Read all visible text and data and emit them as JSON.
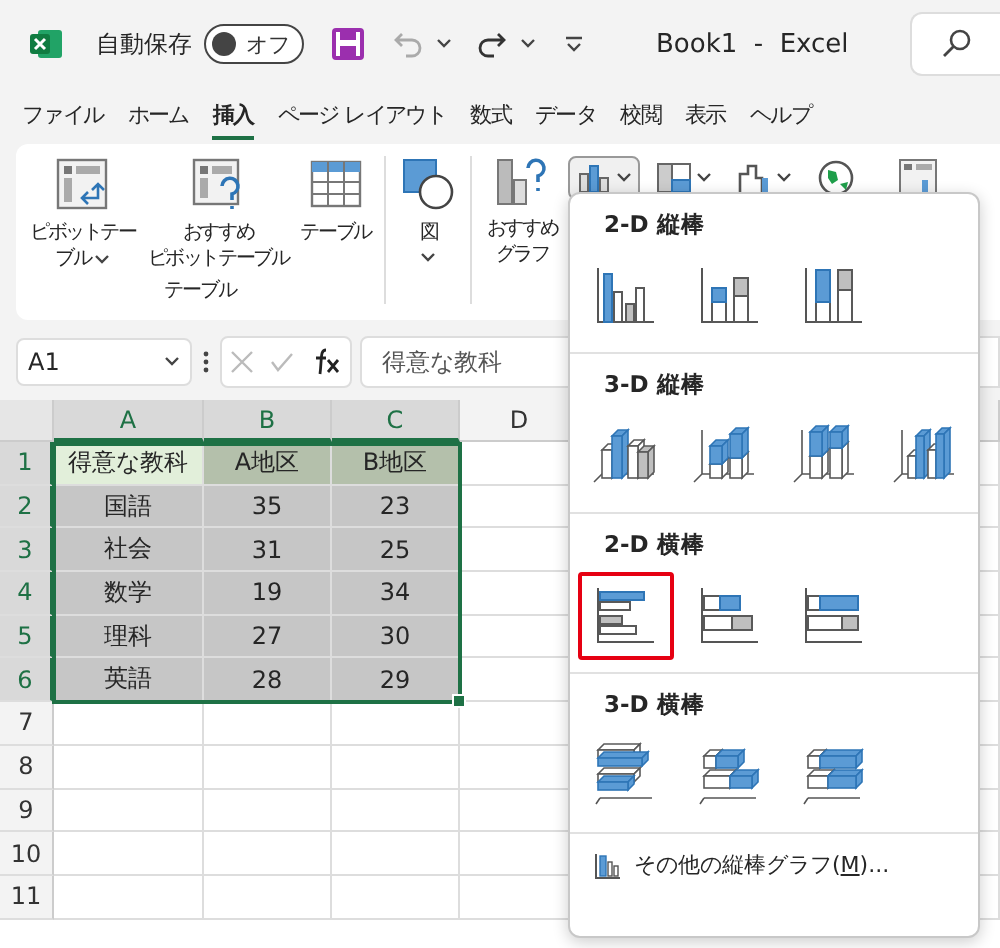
{
  "title_bar": {
    "autosave_label": "自動保存",
    "autosave_toggle": {
      "on": false,
      "label": "オフ"
    },
    "title": "Book1  -  Excel"
  },
  "menu_tabs": [
    {
      "label": "ファイル",
      "selected": false
    },
    {
      "label": "ホーム",
      "selected": false
    },
    {
      "label": "挿入",
      "selected": true
    },
    {
      "label": "ページ レイアウト",
      "selected": false
    },
    {
      "label": "数式",
      "selected": false
    },
    {
      "label": "データ",
      "selected": false
    },
    {
      "label": "校閲",
      "selected": false
    },
    {
      "label": "表示",
      "selected": false
    },
    {
      "label": "ヘルプ",
      "selected": false
    }
  ],
  "ribbon": {
    "groups": [
      {
        "label": "テーブル",
        "buttons": [
          {
            "kind": "pivot-table",
            "lines": [
              "ピボットテー",
              "ブル"
            ],
            "dropdown": true
          },
          {
            "kind": "recommended-pivot",
            "lines": [
              "おすすめ",
              "ピボットテーブル"
            ],
            "dropdown": false
          },
          {
            "kind": "table",
            "lines": [
              "テーブル"
            ],
            "dropdown": false
          }
        ]
      },
      {
        "buttons": [
          {
            "kind": "illustrations",
            "lines": [
              "図"
            ],
            "dropdown": true
          }
        ]
      },
      {
        "buttons": [
          {
            "kind": "recommended-charts",
            "lines": [
              "おすすめ",
              "グラフ"
            ],
            "dropdown": false
          }
        ],
        "chart_tools": [
          {
            "kind": "column",
            "dropdown": true,
            "pressed": true
          },
          {
            "kind": "hierarchy",
            "dropdown": true,
            "pressed": false
          },
          {
            "kind": "waterfall",
            "dropdown": true,
            "pressed": false
          },
          {
            "kind": "map",
            "dropdown": false,
            "pressed": false
          },
          {
            "kind": "pivot-chart",
            "dropdown": false,
            "pressed": false
          }
        ]
      }
    ]
  },
  "formula_bar": {
    "name_box": "A1",
    "formula": "得意な教科"
  },
  "sheet": {
    "columns": [
      {
        "label": "A",
        "selected": true
      },
      {
        "label": "B",
        "selected": true
      },
      {
        "label": "C",
        "selected": true
      },
      {
        "label": "D",
        "selected": false
      }
    ],
    "rows": [
      {
        "number": "1",
        "selected": true,
        "kind": "header",
        "cells": [
          {
            "text": "得意な教科",
            "active": true
          },
          {
            "text": "A地区",
            "active": false
          },
          {
            "text": "B地区",
            "active": false
          }
        ]
      },
      {
        "number": "2",
        "selected": true,
        "kind": "data",
        "cells": [
          {
            "text": "国語",
            "active": false
          },
          {
            "text": "35",
            "active": false
          },
          {
            "text": "23",
            "active": false
          }
        ]
      },
      {
        "number": "3",
        "selected": true,
        "kind": "data",
        "cells": [
          {
            "text": "社会",
            "active": false
          },
          {
            "text": "31",
            "active": false
          },
          {
            "text": "25",
            "active": false
          }
        ]
      },
      {
        "number": "4",
        "selected": true,
        "kind": "data",
        "cells": [
          {
            "text": "数学",
            "active": false
          },
          {
            "text": "19",
            "active": false
          },
          {
            "text": "34",
            "active": false
          }
        ]
      },
      {
        "number": "5",
        "selected": true,
        "kind": "data",
        "cells": [
          {
            "text": "理科",
            "active": false
          },
          {
            "text": "27",
            "active": false
          },
          {
            "text": "30",
            "active": false
          }
        ]
      },
      {
        "number": "6",
        "selected": true,
        "kind": "data",
        "cells": [
          {
            "text": "英語",
            "active": false
          },
          {
            "text": "28",
            "active": false
          },
          {
            "text": "29",
            "active": false
          }
        ]
      },
      {
        "number": "7",
        "selected": false,
        "kind": "data"
      },
      {
        "number": "8",
        "selected": false,
        "kind": "data"
      },
      {
        "number": "9",
        "selected": false,
        "kind": "data"
      },
      {
        "number": "10",
        "selected": false,
        "kind": "data"
      },
      {
        "number": "11",
        "selected": false,
        "kind": "data"
      }
    ]
  },
  "chart_menu": {
    "sections": [
      {
        "title": "2-D 縦棒",
        "items": [
          {
            "kind": "clustered-column",
            "selected": false
          },
          {
            "kind": "stacked-column",
            "selected": false
          },
          {
            "kind": "stacked-column-100",
            "selected": false
          }
        ]
      },
      {
        "title": "3-D 縦棒",
        "items": [
          {
            "kind": "clustered-column-3d",
            "selected": false
          },
          {
            "kind": "stacked-column-3d",
            "selected": false
          },
          {
            "kind": "stacked-column-100-3d",
            "selected": false
          },
          {
            "kind": "column-3d",
            "selected": false
          }
        ]
      },
      {
        "title": "2-D 横棒",
        "items": [
          {
            "kind": "clustered-bar",
            "selected": true
          },
          {
            "kind": "stacked-bar",
            "selected": false
          },
          {
            "kind": "stacked-bar-100",
            "selected": false
          }
        ]
      },
      {
        "title": "3-D 横棒",
        "items": [
          {
            "kind": "clustered-bar-3d",
            "selected": false
          },
          {
            "kind": "stacked-bar-3d",
            "selected": false
          },
          {
            "kind": "stacked-bar-100-3d",
            "selected": false
          }
        ]
      }
    ],
    "footer": {
      "label_before": "その他の縦棒グラフ(",
      "access_key": "M",
      "label_after": ")..."
    }
  }
}
